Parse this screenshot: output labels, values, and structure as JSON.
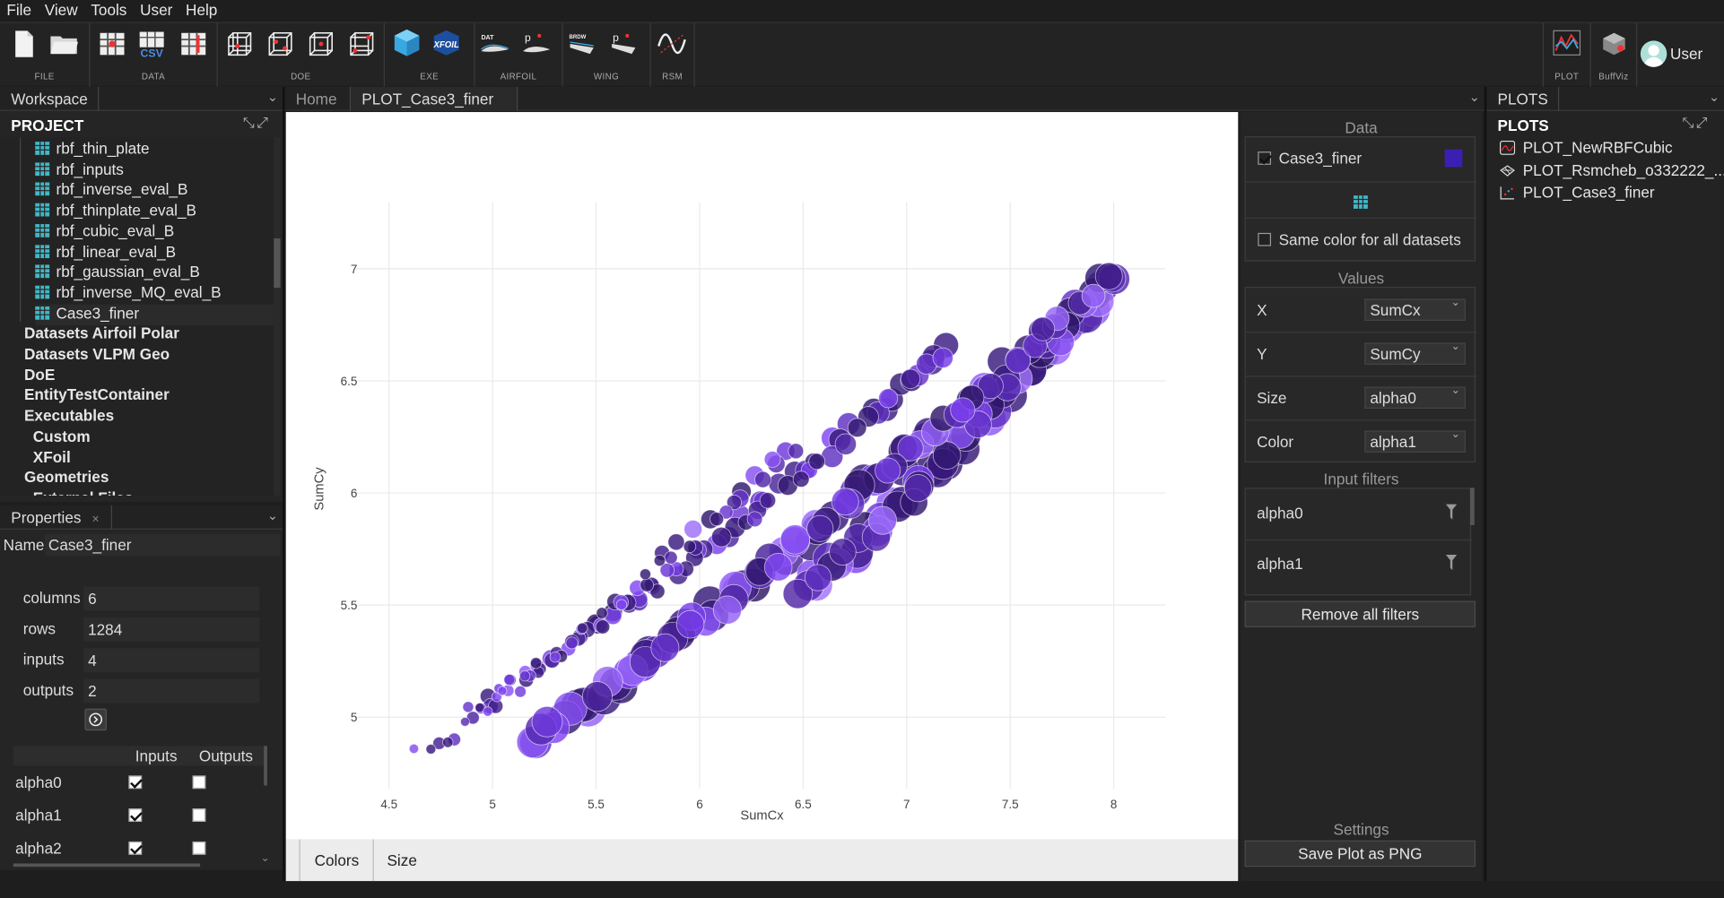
{
  "menu": [
    "File",
    "View",
    "Tools",
    "User",
    "Help"
  ],
  "toolbar": {
    "groups": [
      "FILE",
      "DATA",
      "DOE",
      "EXE",
      "AIRFOIL",
      "WING",
      "RSM"
    ],
    "right_groups": [
      "PLOT",
      "BuffViz"
    ],
    "user_label": "User",
    "icon_dat": "DAT",
    "icon_p": "p",
    "icon_brdw": "BRDW",
    "icon_csv": "CSV",
    "icon_xfoil": "XFOIL"
  },
  "workspace": {
    "tab": "Workspace",
    "project_title": "PROJECT",
    "tree": [
      {
        "label": "rbf_thin_plate",
        "type": "table"
      },
      {
        "label": "rbf_inputs",
        "type": "table"
      },
      {
        "label": "rbf_inverse_eval_B",
        "type": "table"
      },
      {
        "label": "rbf_thinplate_eval_B",
        "type": "table"
      },
      {
        "label": "rbf_cubic_eval_B",
        "type": "table"
      },
      {
        "label": "rbf_linear_eval_B",
        "type": "table"
      },
      {
        "label": "rbf_gaussian_eval_B",
        "type": "table"
      },
      {
        "label": "rbf_inverse_MQ_eval_B",
        "type": "table"
      },
      {
        "label": "Case3_finer",
        "type": "table"
      },
      {
        "label": "Datasets Airfoil Polar",
        "type": "folder"
      },
      {
        "label": "Datasets VLPM Geo",
        "type": "folder"
      },
      {
        "label": "DoE",
        "type": "folder"
      },
      {
        "label": "EntityTestContainer",
        "type": "folder"
      },
      {
        "label": "Executables",
        "type": "folder"
      },
      {
        "label": "Custom",
        "type": "sub"
      },
      {
        "label": "XFoil",
        "type": "sub"
      },
      {
        "label": "Geometries",
        "type": "folder"
      },
      {
        "label": "External Files",
        "type": "sub"
      }
    ]
  },
  "properties": {
    "tab": "Properties",
    "name_label": "Name",
    "name_value": "Case3_finer",
    "fields": [
      {
        "label": "columns",
        "value": "6"
      },
      {
        "label": "rows",
        "value": "1284"
      },
      {
        "label": "inputs",
        "value": "4"
      },
      {
        "label": "outputs",
        "value": "2"
      }
    ],
    "table_headers": [
      "Inputs",
      "Outputs"
    ],
    "table_rows": [
      {
        "name": "alpha0",
        "input": true,
        "output": false
      },
      {
        "name": "alpha1",
        "input": true,
        "output": false
      },
      {
        "name": "alpha2",
        "input": true,
        "output": false
      }
    ]
  },
  "center": {
    "tabs": [
      "Home",
      "PLOT_Case3_finer"
    ],
    "close_glyph": "×",
    "bottom_tabs": [
      "Colors",
      "Size"
    ]
  },
  "chart_data": {
    "type": "scatter",
    "xlabel": "SumCx",
    "ylabel": "SumCy",
    "xlim": [
      4.4,
      8.25
    ],
    "ylim": [
      4.72,
      7.15
    ],
    "xticks": [
      4.5,
      5,
      5.5,
      6,
      6.5,
      7,
      7.5,
      8
    ],
    "yticks": [
      5,
      5.5,
      6,
      6.5,
      7
    ],
    "size_by": "alpha0",
    "color_by": "alpha1",
    "grid": true,
    "colors": {
      "light": "#b48cff",
      "mid": "#7a3ff0",
      "dark": "#3a1a80",
      "darkest": "#2a1560"
    },
    "bands": [
      {
        "x0": 4.65,
        "y0": 4.83,
        "x1": 6.45,
        "y1": 6.22,
        "s0": 0.15,
        "s1": 0.35,
        "c0": 0.1,
        "c1": 0.9,
        "n": 48
      },
      {
        "x0": 4.9,
        "y0": 5.03,
        "x1": 7.2,
        "y1": 6.65,
        "s0": 0.2,
        "s1": 0.55,
        "c0": 0.3,
        "c1": 0.85,
        "n": 80
      },
      {
        "x0": 5.2,
        "y0": 4.9,
        "x1": 7.95,
        "y1": 6.95,
        "s0": 0.9,
        "s1": 0.7,
        "c0": 0.15,
        "c1": 0.95,
        "n": 95
      },
      {
        "x0": 6.5,
        "y0": 5.56,
        "x1": 8.0,
        "y1": 6.97,
        "s0": 0.8,
        "s1": 0.85,
        "c0": 0.1,
        "c1": 0.95,
        "n": 60
      }
    ]
  },
  "right": {
    "data_title": "Data",
    "dataset_name": "Case3_finer",
    "dataset_color": "#3b1fb5",
    "same_color_label": "Same color for all datasets",
    "values_title": "Values",
    "mappings": [
      {
        "label": "X",
        "value": "SumCx"
      },
      {
        "label": "Y",
        "value": "SumCy"
      },
      {
        "label": "Size",
        "value": "alpha0"
      },
      {
        "label": "Color",
        "value": "alpha1"
      }
    ],
    "filters_title": "Input filters",
    "filters": [
      "alpha0",
      "alpha1"
    ],
    "remove_filters": "Remove all filters",
    "settings_title": "Settings",
    "save_png": "Save Plot as PNG"
  },
  "plots": {
    "tab": "PLOTS",
    "title": "PLOTS",
    "items": [
      "PLOT_NewRBFCubic",
      "PLOT_Rsmcheb_o332222_...",
      "PLOT_Case3_finer"
    ]
  }
}
